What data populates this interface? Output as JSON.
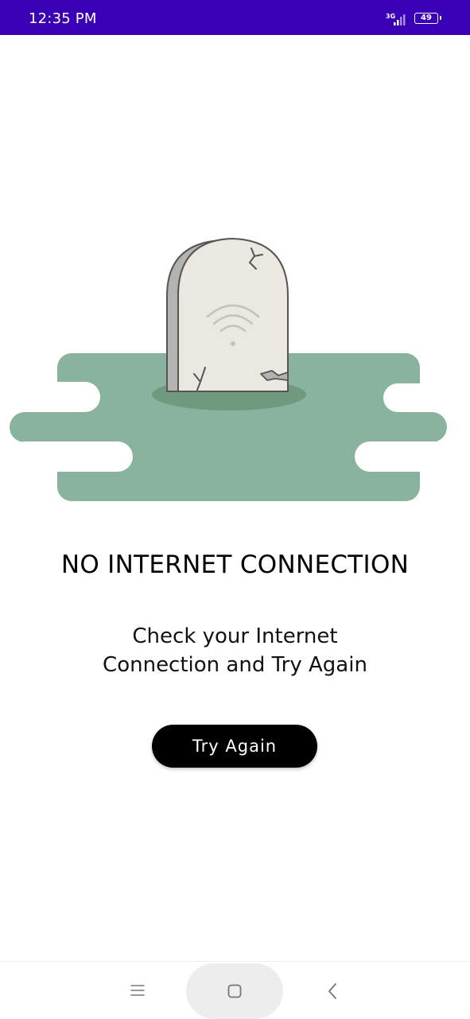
{
  "status_bar": {
    "time": "12:35 PM",
    "network_type": "3G",
    "battery_level": "49",
    "icons": [
      "signal-icon",
      "battery-icon"
    ]
  },
  "illustration": {
    "icons": [
      "tombstone-wifi-icon"
    ],
    "colors": {
      "ground": "#8ab39f",
      "ground_shadow": "#6f9a80",
      "stone": "#ebe8e2",
      "stone_edge": "#b3b3b0"
    }
  },
  "main": {
    "title": "NO INTERNET CONNECTION",
    "message_line1": "Check your Internet",
    "message_line2": "Connection and Try Again",
    "retry_label": "Try Again"
  },
  "nav_bar": {
    "icons": [
      "menu-icon",
      "home-icon",
      "back-icon"
    ]
  },
  "colors": {
    "status_bar": "#3a00b5",
    "button_bg": "#000000",
    "button_text": "#ffffff"
  }
}
